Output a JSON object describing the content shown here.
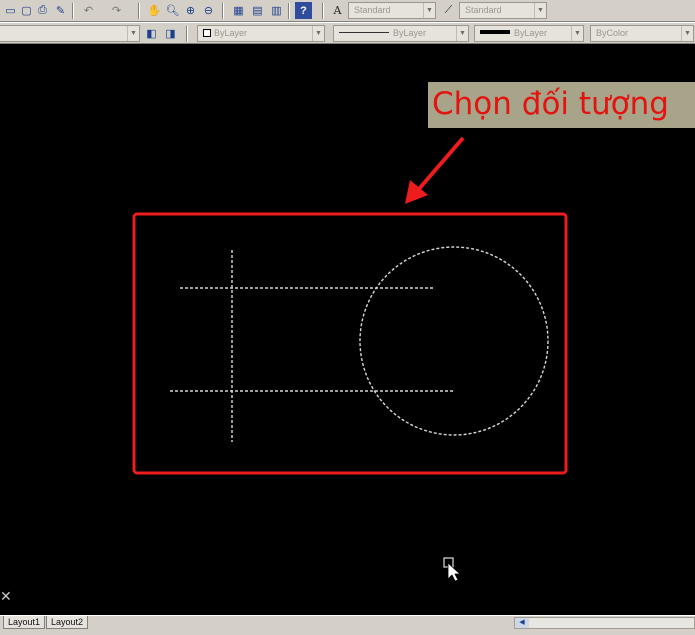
{
  "toolbar": {
    "row1": {
      "text_style_value": "Standard",
      "dim_style_value": "Standard"
    },
    "row2": {
      "color_value": "ByLayer",
      "linetype_value": "ByLayer",
      "lineweight_value": "ByLayer",
      "plotstyle_value": "ByColor"
    }
  },
  "annotation": {
    "callout_text": "Chọn đối tượng"
  },
  "layout_tabs": [
    "Layout1",
    "Layout2"
  ],
  "colors": {
    "canvas": "#000000",
    "highlight_rectangle": "#ee1c1c",
    "callout_background": "#a8a48a",
    "callout_text": "#e3140f",
    "dashed_geometry": "#d8d8d8"
  }
}
